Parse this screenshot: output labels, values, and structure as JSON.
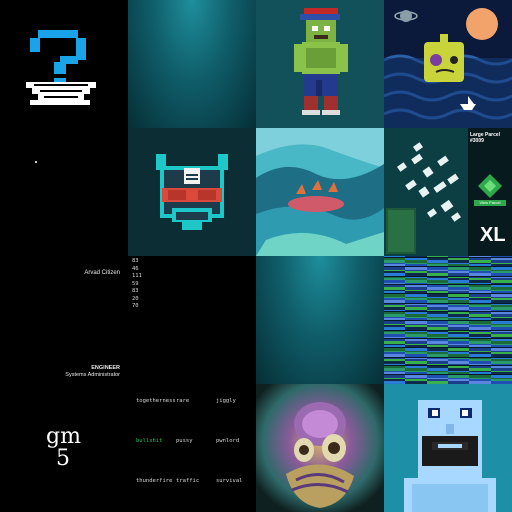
{
  "tiles": {
    "citizen": {
      "name": "Arvad Citizen",
      "role": "ENGINEER",
      "subtitle": "Systems Administrator"
    },
    "numbers": [
      "83",
      "46",
      "111",
      "59",
      "83",
      "20",
      "70"
    ],
    "words": {
      "row1": [
        "togetherness",
        "rare",
        "jiggly"
      ],
      "row2": [
        "bullshit",
        "pussy",
        "pwnlord"
      ],
      "row3": [
        "thunderfire",
        "traffic",
        "survival"
      ]
    },
    "gm": {
      "line1": "gm",
      "line2": "5"
    },
    "parcel": {
      "title": "Large Parcel #3009",
      "size_label": "XL",
      "button_label": "View Parcel"
    }
  },
  "colors": {
    "teal": "#12505a",
    "green_word": "#22c55e",
    "pixel_blue": "#1aa3e8"
  }
}
